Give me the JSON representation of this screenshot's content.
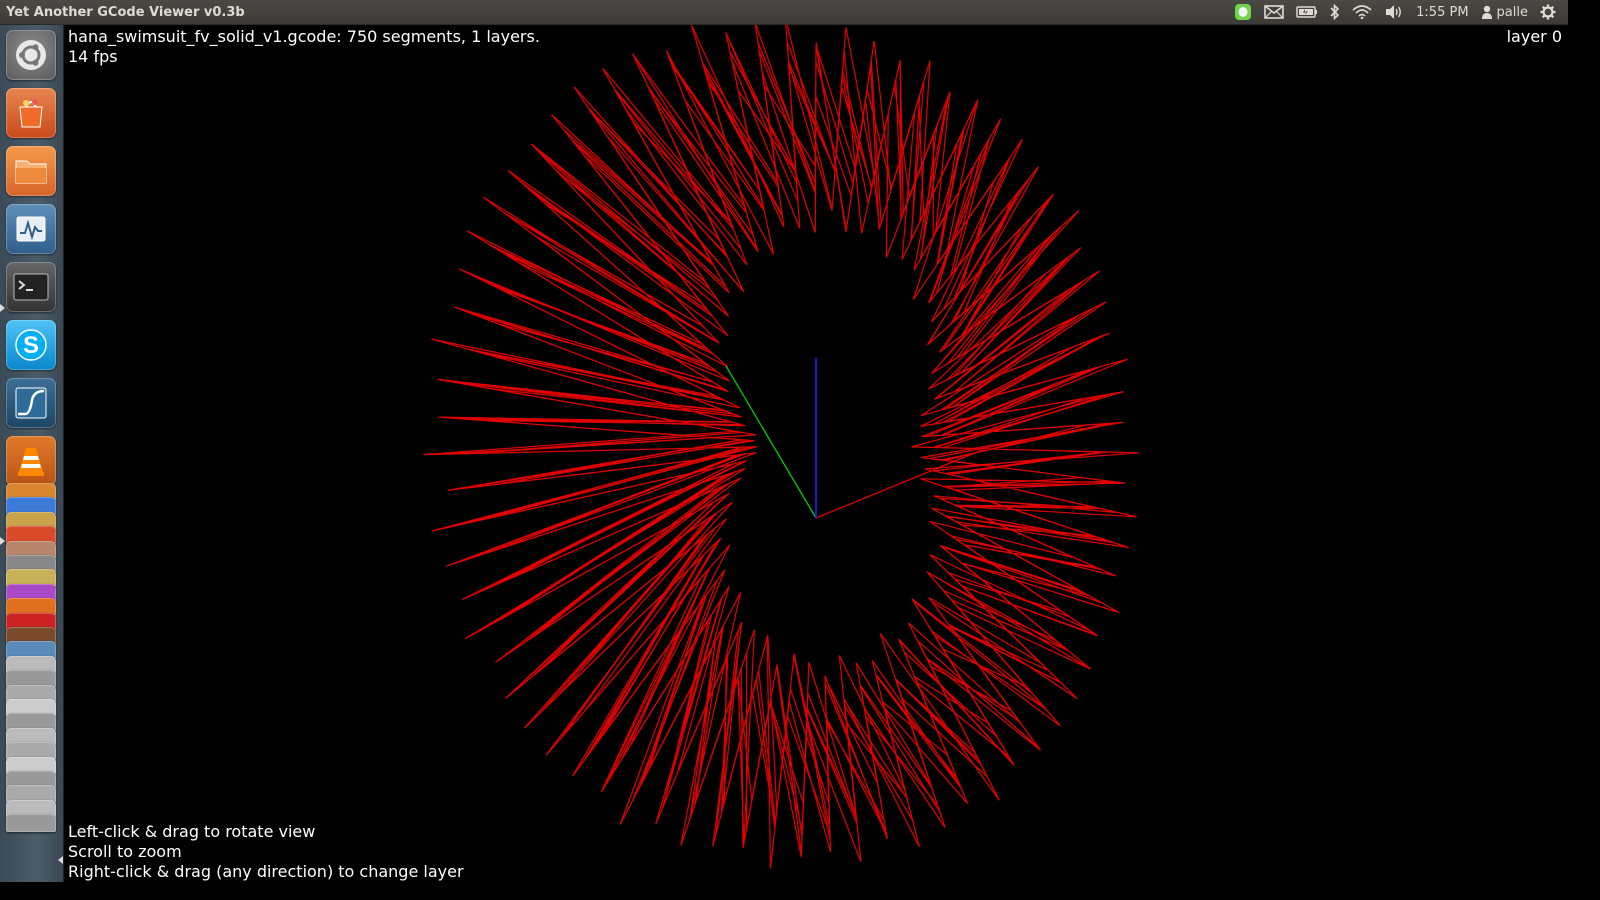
{
  "topbar": {
    "title": "Yet Another GCode Viewer v0.3b",
    "clock": "1:55 PM",
    "user": "palle",
    "indicators": [
      "evernote-icon",
      "mail-icon",
      "battery-icon",
      "bluetooth-icon",
      "wifi-icon",
      "volume-icon",
      "user-icon",
      "gear-icon"
    ]
  },
  "launcher": {
    "apps": [
      "ubuntu-dash-icon",
      "software-center-icon",
      "files-icon",
      "system-monitor-icon",
      "terminal-icon",
      "skype-icon",
      "wireshark-icon",
      "vlc-icon"
    ],
    "collapsed_stack_count": 24
  },
  "viewer": {
    "file_info": "hana_swimsuit_fv_solid_v1.gcode: 750 segments, 1 layers.",
    "fps": "14 fps",
    "layer": "layer 0",
    "help": [
      "Left-click & drag to rotate view",
      "Scroll to zoom",
      "Right-click & drag (any direction) to change layer"
    ],
    "segment_color": "#e00000",
    "axis_colors": {
      "x": "#e00000",
      "y": "#00cc00",
      "z": "#2020ff"
    }
  },
  "colors": {
    "panel_bg": "#3c3b37",
    "panel_text": "#dfdbd2",
    "viewport_bg": "#000000"
  }
}
